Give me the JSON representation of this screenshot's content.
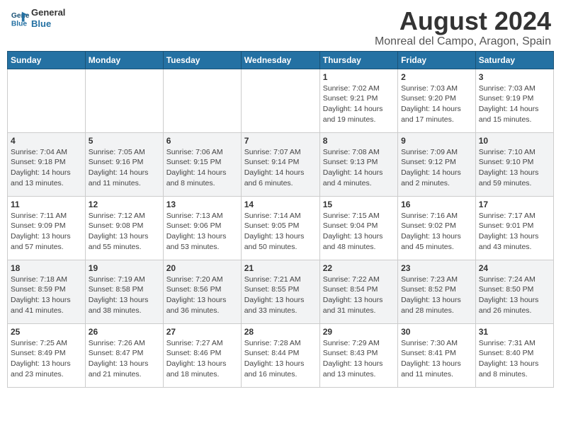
{
  "logo": {
    "text1": "General",
    "text2": "Blue"
  },
  "title": "August 2024",
  "subtitle": "Monreal del Campo, Aragon, Spain",
  "days_header": [
    "Sunday",
    "Monday",
    "Tuesday",
    "Wednesday",
    "Thursday",
    "Friday",
    "Saturday"
  ],
  "weeks": [
    [
      {
        "day": "",
        "info": ""
      },
      {
        "day": "",
        "info": ""
      },
      {
        "day": "",
        "info": ""
      },
      {
        "day": "",
        "info": ""
      },
      {
        "day": "1",
        "info": "Sunrise: 7:02 AM\nSunset: 9:21 PM\nDaylight: 14 hours\nand 19 minutes."
      },
      {
        "day": "2",
        "info": "Sunrise: 7:03 AM\nSunset: 9:20 PM\nDaylight: 14 hours\nand 17 minutes."
      },
      {
        "day": "3",
        "info": "Sunrise: 7:03 AM\nSunset: 9:19 PM\nDaylight: 14 hours\nand 15 minutes."
      }
    ],
    [
      {
        "day": "4",
        "info": "Sunrise: 7:04 AM\nSunset: 9:18 PM\nDaylight: 14 hours\nand 13 minutes."
      },
      {
        "day": "5",
        "info": "Sunrise: 7:05 AM\nSunset: 9:16 PM\nDaylight: 14 hours\nand 11 minutes."
      },
      {
        "day": "6",
        "info": "Sunrise: 7:06 AM\nSunset: 9:15 PM\nDaylight: 14 hours\nand 8 minutes."
      },
      {
        "day": "7",
        "info": "Sunrise: 7:07 AM\nSunset: 9:14 PM\nDaylight: 14 hours\nand 6 minutes."
      },
      {
        "day": "8",
        "info": "Sunrise: 7:08 AM\nSunset: 9:13 PM\nDaylight: 14 hours\nand 4 minutes."
      },
      {
        "day": "9",
        "info": "Sunrise: 7:09 AM\nSunset: 9:12 PM\nDaylight: 14 hours\nand 2 minutes."
      },
      {
        "day": "10",
        "info": "Sunrise: 7:10 AM\nSunset: 9:10 PM\nDaylight: 13 hours\nand 59 minutes."
      }
    ],
    [
      {
        "day": "11",
        "info": "Sunrise: 7:11 AM\nSunset: 9:09 PM\nDaylight: 13 hours\nand 57 minutes."
      },
      {
        "day": "12",
        "info": "Sunrise: 7:12 AM\nSunset: 9:08 PM\nDaylight: 13 hours\nand 55 minutes."
      },
      {
        "day": "13",
        "info": "Sunrise: 7:13 AM\nSunset: 9:06 PM\nDaylight: 13 hours\nand 53 minutes."
      },
      {
        "day": "14",
        "info": "Sunrise: 7:14 AM\nSunset: 9:05 PM\nDaylight: 13 hours\nand 50 minutes."
      },
      {
        "day": "15",
        "info": "Sunrise: 7:15 AM\nSunset: 9:04 PM\nDaylight: 13 hours\nand 48 minutes."
      },
      {
        "day": "16",
        "info": "Sunrise: 7:16 AM\nSunset: 9:02 PM\nDaylight: 13 hours\nand 45 minutes."
      },
      {
        "day": "17",
        "info": "Sunrise: 7:17 AM\nSunset: 9:01 PM\nDaylight: 13 hours\nand 43 minutes."
      }
    ],
    [
      {
        "day": "18",
        "info": "Sunrise: 7:18 AM\nSunset: 8:59 PM\nDaylight: 13 hours\nand 41 minutes."
      },
      {
        "day": "19",
        "info": "Sunrise: 7:19 AM\nSunset: 8:58 PM\nDaylight: 13 hours\nand 38 minutes."
      },
      {
        "day": "20",
        "info": "Sunrise: 7:20 AM\nSunset: 8:56 PM\nDaylight: 13 hours\nand 36 minutes."
      },
      {
        "day": "21",
        "info": "Sunrise: 7:21 AM\nSunset: 8:55 PM\nDaylight: 13 hours\nand 33 minutes."
      },
      {
        "day": "22",
        "info": "Sunrise: 7:22 AM\nSunset: 8:54 PM\nDaylight: 13 hours\nand 31 minutes."
      },
      {
        "day": "23",
        "info": "Sunrise: 7:23 AM\nSunset: 8:52 PM\nDaylight: 13 hours\nand 28 minutes."
      },
      {
        "day": "24",
        "info": "Sunrise: 7:24 AM\nSunset: 8:50 PM\nDaylight: 13 hours\nand 26 minutes."
      }
    ],
    [
      {
        "day": "25",
        "info": "Sunrise: 7:25 AM\nSunset: 8:49 PM\nDaylight: 13 hours\nand 23 minutes."
      },
      {
        "day": "26",
        "info": "Sunrise: 7:26 AM\nSunset: 8:47 PM\nDaylight: 13 hours\nand 21 minutes."
      },
      {
        "day": "27",
        "info": "Sunrise: 7:27 AM\nSunset: 8:46 PM\nDaylight: 13 hours\nand 18 minutes."
      },
      {
        "day": "28",
        "info": "Sunrise: 7:28 AM\nSunset: 8:44 PM\nDaylight: 13 hours\nand 16 minutes."
      },
      {
        "day": "29",
        "info": "Sunrise: 7:29 AM\nSunset: 8:43 PM\nDaylight: 13 hours\nand 13 minutes."
      },
      {
        "day": "30",
        "info": "Sunrise: 7:30 AM\nSunset: 8:41 PM\nDaylight: 13 hours\nand 11 minutes."
      },
      {
        "day": "31",
        "info": "Sunrise: 7:31 AM\nSunset: 8:40 PM\nDaylight: 13 hours\nand 8 minutes."
      }
    ]
  ]
}
